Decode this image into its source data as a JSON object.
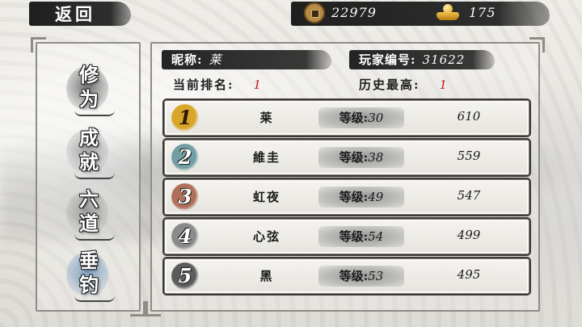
{
  "header": {
    "back_label": "返回",
    "copper_coins": "22979",
    "gold_ingots": "175",
    "coin_icon": "copper-coin-icon",
    "ingot_icon": "gold-ingot-icon"
  },
  "tabs": [
    {
      "label": "修为",
      "state": "active"
    },
    {
      "label": "成就",
      "state": "normal"
    },
    {
      "label": "六道",
      "state": "normal"
    },
    {
      "label": "垂钓",
      "state": "highlight"
    }
  ],
  "player": {
    "nickname_label": "昵称:",
    "nickname": "莱",
    "id_label": "玩家编号:",
    "id": "31622",
    "current_rank_label": "当前排名:",
    "current_rank": "1",
    "best_rank_label": "历史最高:",
    "best_rank": "1"
  },
  "leaderboard": [
    {
      "rank": "1",
      "name": "莱",
      "level_label": "等级:",
      "level": "30",
      "score": "610",
      "badge_color": "#d9a52a"
    },
    {
      "rank": "2",
      "name": "維圭",
      "level_label": "等级:",
      "level": "38",
      "score": "559",
      "badge_color": "#6f9ea3"
    },
    {
      "rank": "3",
      "name": "虹夜",
      "level_label": "等级:",
      "level": "49",
      "score": "547",
      "badge_color": "#b06f5a"
    },
    {
      "rank": "4",
      "name": "心弦",
      "level_label": "等级:",
      "level": "54",
      "score": "499",
      "badge_color": "#8a8a8a"
    },
    {
      "rank": "5",
      "name": "黑",
      "level_label": "等级:",
      "level": "53",
      "score": "495",
      "badge_color": "#5c5c5c"
    }
  ],
  "colors": {
    "ink": "#1b1b1b",
    "accent_red": "#c11b1b",
    "frame": "#8f8c86"
  }
}
